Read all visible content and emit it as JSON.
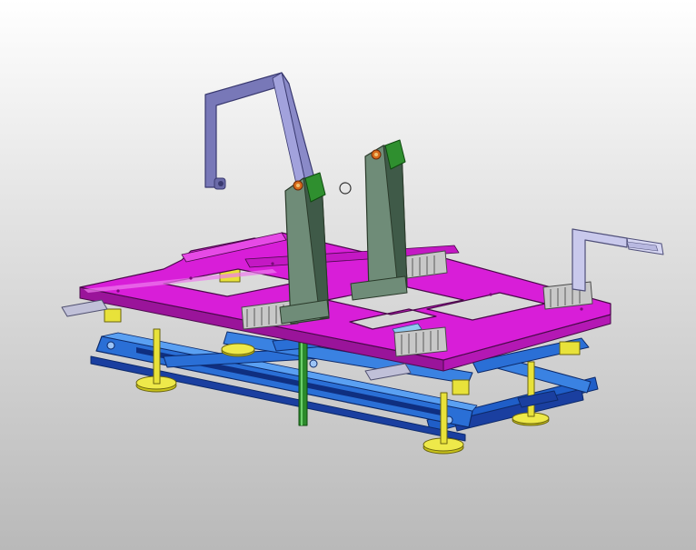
{
  "viewport": {
    "background_top": "#ffffff",
    "background_bottom": "#b9b9b9"
  },
  "model": {
    "parts": [
      "base-frame",
      "scissor-arms",
      "leveling-feet",
      "support-posts",
      "top-platform",
      "clamp-blocks",
      "vertical-columns",
      "handle-left",
      "bracket-right",
      "center-shaft"
    ],
    "colors": {
      "platform": "#d81ed8",
      "platform_edge": "#8a128a",
      "frame": "#2a6fd6",
      "frame_dark": "#1a3fa0",
      "frame_light": "#4f94ee",
      "columns": "#6f8c78",
      "columns_dark": "#3f5a48",
      "green_plate": "#2f8f2f",
      "shaft": "#2b8a2b",
      "handle": "#8a8ac8",
      "handle_dark": "#5a5a98",
      "bracket": "#c9c9ec",
      "feet": "#e8e23a",
      "feet_dark": "#9a941a",
      "clamp": "#c8c8c8",
      "clamp_dark": "#6e6e6e",
      "bolt": "#d86a1a"
    }
  }
}
